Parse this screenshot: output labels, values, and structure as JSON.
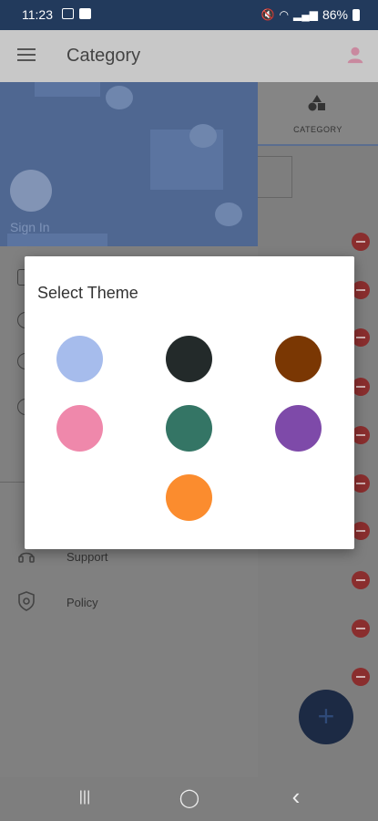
{
  "status_bar": {
    "time": "11:23",
    "battery": "86%",
    "icons": [
      "image-icon",
      "check-box-icon",
      "mute-icon",
      "wifi-icon",
      "signal-icon",
      "battery-icon"
    ]
  },
  "app_bar": {
    "title": "Category",
    "menu_icon": "hamburger-menu-icon",
    "profile_icon": "person-icon"
  },
  "drawer": {
    "sign_in": "Sign In",
    "items": [
      {
        "label": "Support",
        "icon": "support-icon"
      },
      {
        "label": "Policy",
        "icon": "shield-icon"
      }
    ]
  },
  "tabs": [
    {
      "label": "CATEGORY",
      "icon": "shapes-icon"
    }
  ],
  "dialog": {
    "title": "Select Theme",
    "colors": [
      "#a6bcec",
      "#232a2a",
      "#7a3703",
      "#ef88ab",
      "#347565",
      "#7e4aa9",
      "#fb8c2e"
    ]
  },
  "fab": {
    "label": "+"
  },
  "nav_bar": {
    "recent": "|||",
    "home": "◯",
    "back": "‹"
  }
}
